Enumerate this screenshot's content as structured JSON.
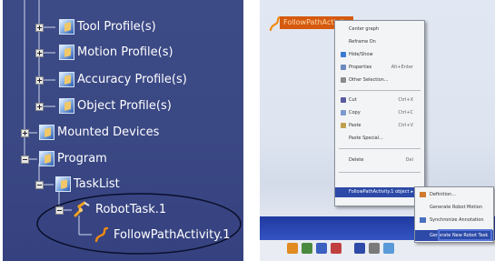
{
  "tree": {
    "nodes": [
      {
        "label": "Tool Profile(s)"
      },
      {
        "label": "Motion Profile(s)"
      },
      {
        "label": "Accuracy Profile(s)"
      },
      {
        "label": "Object Profile(s)"
      },
      {
        "label": "Mounted Devices"
      },
      {
        "label": "Program"
      },
      {
        "label": "TaskList"
      },
      {
        "label": "RobotTask.1"
      },
      {
        "label": "FollowPathActivity.1"
      }
    ]
  },
  "viewer": {
    "object_label": "FollowPathActivity",
    "context_menu": {
      "items": [
        {
          "label": "Center graph",
          "shortcut": "",
          "icon": "center-graph-icon"
        },
        {
          "label": "Reframe On",
          "shortcut": "",
          "icon": "reframe-icon"
        },
        {
          "label": "Hide/Show",
          "shortcut": "",
          "icon": "hide-show-icon"
        },
        {
          "label": "Properties",
          "shortcut": "Alt+Enter",
          "icon": "properties-icon"
        },
        {
          "label": "Other Selection...",
          "shortcut": "",
          "icon": "other-selection-icon"
        },
        {
          "label": "Cut",
          "shortcut": "Ctrl+X",
          "icon": "cut-icon"
        },
        {
          "label": "Copy",
          "shortcut": "Ctrl+C",
          "icon": "copy-icon"
        },
        {
          "label": "Paste",
          "shortcut": "Ctrl+V",
          "icon": "paste-icon"
        },
        {
          "label": "Paste Special...",
          "shortcut": "",
          "icon": ""
        },
        {
          "label": "Delete",
          "shortcut": "Del",
          "icon": ""
        },
        {
          "label": "FollowPathActivity.1 object",
          "shortcut": "",
          "icon": ""
        }
      ]
    },
    "sub_menu": {
      "items": [
        {
          "label": "Definition...",
          "icon": "definition-icon"
        },
        {
          "label": "Generate Robot Motion",
          "icon": "generate-icon"
        },
        {
          "label": "Synchronize Annotation",
          "icon": "sync-icon"
        },
        {
          "label": "Generate New Robot Task",
          "icon": "new-task-icon"
        }
      ]
    }
  }
}
